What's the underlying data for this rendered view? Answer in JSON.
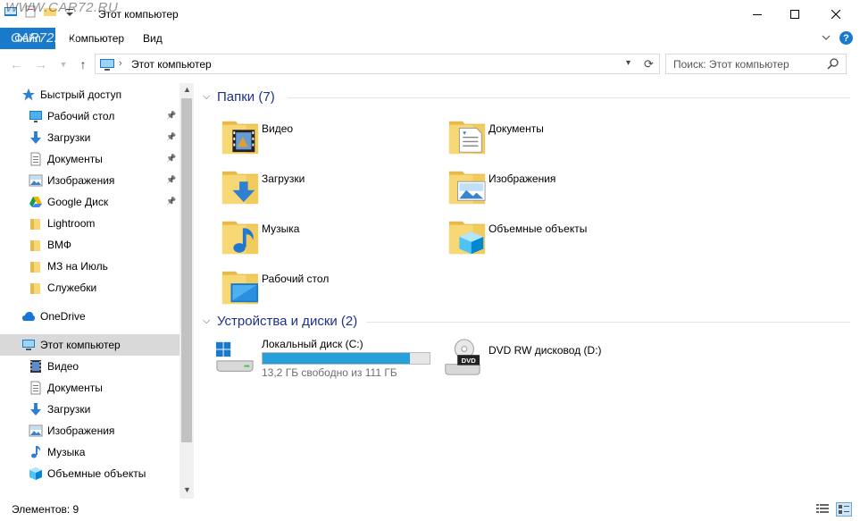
{
  "window": {
    "title": "Этот компьютер",
    "watermark_top": "WWW.CAR72.RU",
    "watermark_logo": "CAR72.RU"
  },
  "ribbon": {
    "tabs": [
      {
        "label": "Файл"
      },
      {
        "label": "Компьютер"
      },
      {
        "label": "Вид"
      }
    ]
  },
  "address": {
    "path": "Этот компьютер",
    "search_placeholder": "Поиск: Этот компьютер"
  },
  "nav": {
    "items": [
      {
        "label": "Быстрый доступ",
        "icon": "star-icon",
        "pinned": false
      },
      {
        "label": "Рабочий стол",
        "icon": "desktop-icon",
        "pinned": true
      },
      {
        "label": "Загрузки",
        "icon": "download-arrow-icon",
        "pinned": true
      },
      {
        "label": "Документы",
        "icon": "document-icon",
        "pinned": true
      },
      {
        "label": "Изображения",
        "icon": "pictures-icon",
        "pinned": true
      },
      {
        "label": "Google Диск",
        "icon": "google-drive-icon",
        "pinned": true
      },
      {
        "label": "Lightroom",
        "icon": "folder-icon",
        "pinned": false
      },
      {
        "label": "ВМФ",
        "icon": "folder-icon",
        "pinned": false
      },
      {
        "label": "МЗ на Июль",
        "icon": "folder-icon",
        "pinned": false
      },
      {
        "label": "Служебки",
        "icon": "folder-icon",
        "pinned": false
      },
      {
        "label": "OneDrive",
        "icon": "cloud-icon",
        "pinned": false
      },
      {
        "label": "Этот компьютер",
        "icon": "computer-icon",
        "pinned": false,
        "selected": true
      },
      {
        "label": "Видео",
        "icon": "video-icon",
        "pinned": false
      },
      {
        "label": "Документы",
        "icon": "document-icon",
        "pinned": false
      },
      {
        "label": "Загрузки",
        "icon": "download-arrow-icon",
        "pinned": false
      },
      {
        "label": "Изображения",
        "icon": "pictures-icon",
        "pinned": false
      },
      {
        "label": "Музыка",
        "icon": "music-note-icon",
        "pinned": false
      },
      {
        "label": "Объемные объекты",
        "icon": "cube-icon",
        "pinned": false
      }
    ]
  },
  "content": {
    "folders_header": "Папки (7)",
    "folders": [
      {
        "label": "Видео",
        "icon": "video-folder-icon"
      },
      {
        "label": "Документы",
        "icon": "documents-folder-icon"
      },
      {
        "label": "Загрузки",
        "icon": "downloads-folder-icon"
      },
      {
        "label": "Изображения",
        "icon": "pictures-folder-icon"
      },
      {
        "label": "Музыка",
        "icon": "music-folder-icon"
      },
      {
        "label": "Объемные объекты",
        "icon": "3d-objects-folder-icon"
      },
      {
        "label": "Рабочий стол",
        "icon": "desktop-folder-icon"
      }
    ],
    "devices_header": "Устройства и диски (2)",
    "drives": [
      {
        "label": "Локальный диск (C:)",
        "free_text": "13,2 ГБ свободно из 111 ГБ",
        "used_fraction": 0.88,
        "icon": "windows-drive-icon"
      },
      {
        "label": "DVD RW дисковод (D:)",
        "icon": "dvd-drive-icon",
        "badge": "DVD"
      }
    ]
  },
  "status": {
    "items_text": "Элементов: 9"
  },
  "colors": {
    "accent": "#1979ca",
    "header_text": "#1e3287",
    "drive_fill": "#26a0da",
    "selection": "#d9d9d9",
    "folder": "#f8d775"
  }
}
